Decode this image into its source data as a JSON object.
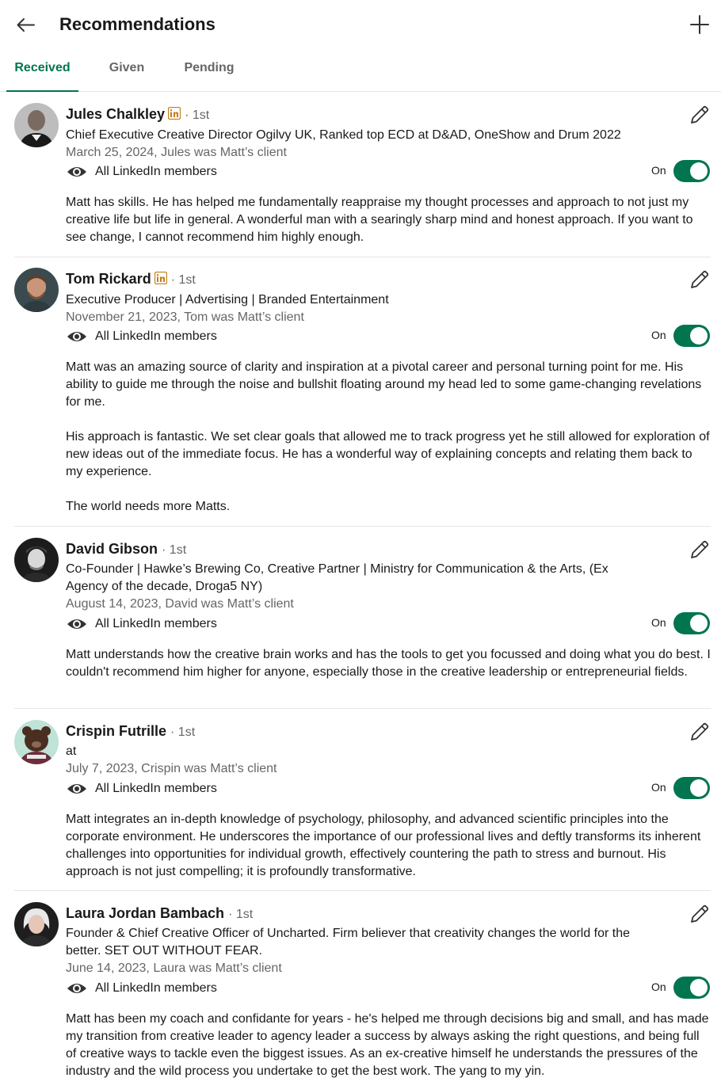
{
  "header": {
    "title": "Recommendations",
    "back_icon": "arrow-left-icon",
    "add_icon": "plus-icon"
  },
  "tabs": [
    {
      "label": "Received",
      "active": true
    },
    {
      "label": "Given",
      "active": false
    },
    {
      "label": "Pending",
      "active": false
    }
  ],
  "colors": {
    "accent": "#01754f",
    "linkedin_badge": "#c37d16",
    "secondary_text": "#666666"
  },
  "recommendations": [
    {
      "name": "Jules Chalkley",
      "has_linkedin_badge": true,
      "degree": "· 1st",
      "headline": "Chief Executive Creative Director Ogilvy UK, Ranked top ECD at D&AD, OneShow and Drum 2022",
      "meta": "March 25, 2024, Jules was Matt’s client",
      "visibility": "All LinkedIn members",
      "toggle_label": "On",
      "toggle_on": true,
      "text": [
        "Matt has skills. He has helped me fundamentally reappraise my thought processes and approach to not just my creative life but life in general. A wonderful man with a searingly sharp mind and honest approach. If you want to see change, I cannot recommend him highly enough."
      ]
    },
    {
      "name": "Tom Rickard",
      "has_linkedin_badge": true,
      "degree": "· 1st",
      "headline": "Executive Producer | Advertising | Branded Entertainment",
      "meta": "November 21, 2023, Tom was Matt’s client",
      "visibility": "All LinkedIn members",
      "toggle_label": "On",
      "toggle_on": true,
      "text": [
        "Matt was an amazing source of clarity and inspiration at a pivotal career and personal turning point for me. His ability to guide me through the noise and bullshit floating around my head led to some game-changing revelations for me.",
        "His approach is fantastic. We set clear goals that allowed me to track progress yet he still allowed for exploration of new ideas out of the immediate focus. He has a wonderful way of explaining concepts and relating them back to my experience.",
        "The world needs more Matts."
      ]
    },
    {
      "name": "David Gibson",
      "has_linkedin_badge": false,
      "degree": "· 1st",
      "headline": "Co-Founder | Hawke’s Brewing Co, Creative Partner | Ministry for Communication & the Arts, (Ex Agency of the decade, Droga5 NY)",
      "meta": "August 14, 2023, David was Matt’s client",
      "visibility": "All LinkedIn members",
      "toggle_label": "On",
      "toggle_on": true,
      "text": [
        "Matt understands how the creative brain works and has the tools to get you focussed and doing what you do best. I couldn't recommend him higher for anyone, especially those in the creative leadership or entrepreneurial fields."
      ]
    },
    {
      "name": "Crispin Futrille",
      "has_linkedin_badge": false,
      "degree": "· 1st",
      "headline": "at",
      "meta": "July 7, 2023, Crispin was Matt’s client",
      "visibility": "All LinkedIn members",
      "toggle_label": "On",
      "toggle_on": true,
      "text": [
        "Matt integrates an in-depth knowledge of psychology, philosophy, and advanced scientific principles into the corporate environment. He underscores the importance of our professional lives and deftly transforms its inherent challenges into opportunities for individual growth, effectively countering the path to stress and burnout. His approach is not just compelling; it is profoundly transformative."
      ]
    },
    {
      "name": "Laura Jordan Bambach",
      "has_linkedin_badge": false,
      "degree": "· 1st",
      "headline": "Founder & Chief Creative Officer of Uncharted. Firm believer that creativity changes the world for the better. SET OUT WITHOUT FEAR.",
      "meta": "June 14, 2023, Laura was Matt’s client",
      "visibility": "All LinkedIn members",
      "toggle_label": "On",
      "toggle_on": true,
      "text": [
        "Matt has been my coach and confidante for years - he's helped me through decisions big and small, and has made my transition from creative leader to agency leader a success by always asking the right questions, and being full of creative ways to tackle even the biggest issues. As an ex-creative himself he understands the pressures of the industry and the wild process you undertake to get the best work. The yang to my yin."
      ]
    }
  ]
}
